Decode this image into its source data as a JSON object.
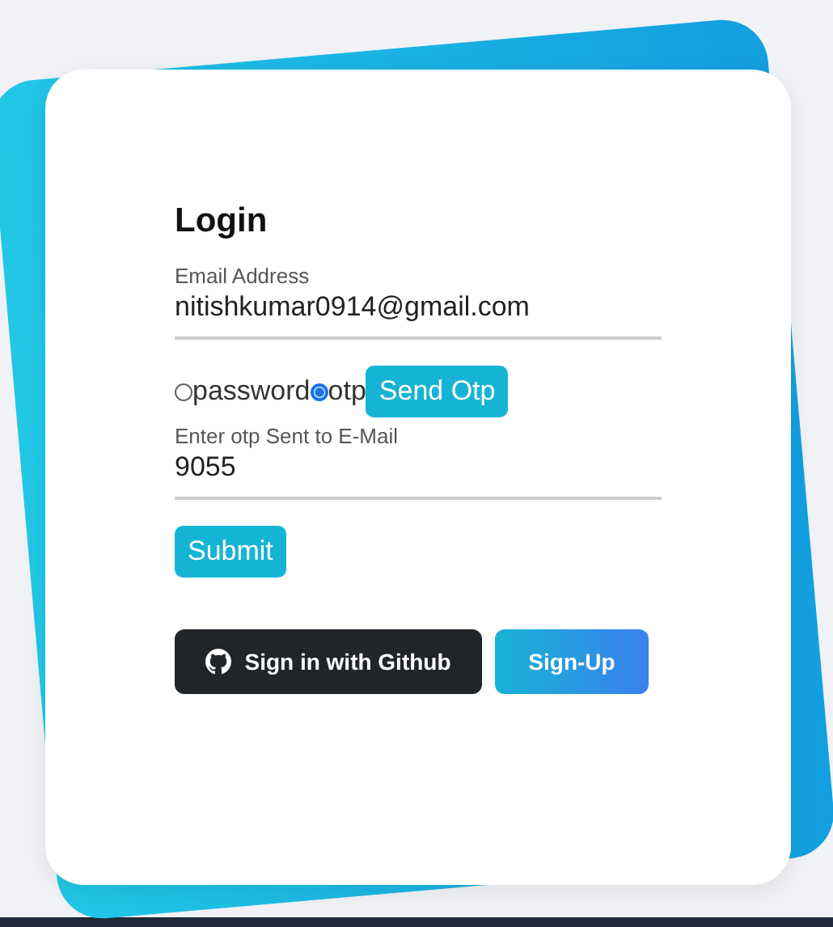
{
  "title": "Login",
  "fields": [
    {
      "label": "Email Address",
      "value": "nitishkumar0914@gmail.com"
    }
  ],
  "login_methods": [
    {
      "label": "password",
      "selected": false
    },
    {
      "label": "otp",
      "selected": true
    }
  ],
  "send_button": "Send Otp",
  "otp_field": {
    "label": "Enter otp Sent to E-Mail",
    "value": "9055"
  },
  "submit_button": "Submit",
  "github_button": "Sign in with Github",
  "signup_button": "Sign-Up"
}
